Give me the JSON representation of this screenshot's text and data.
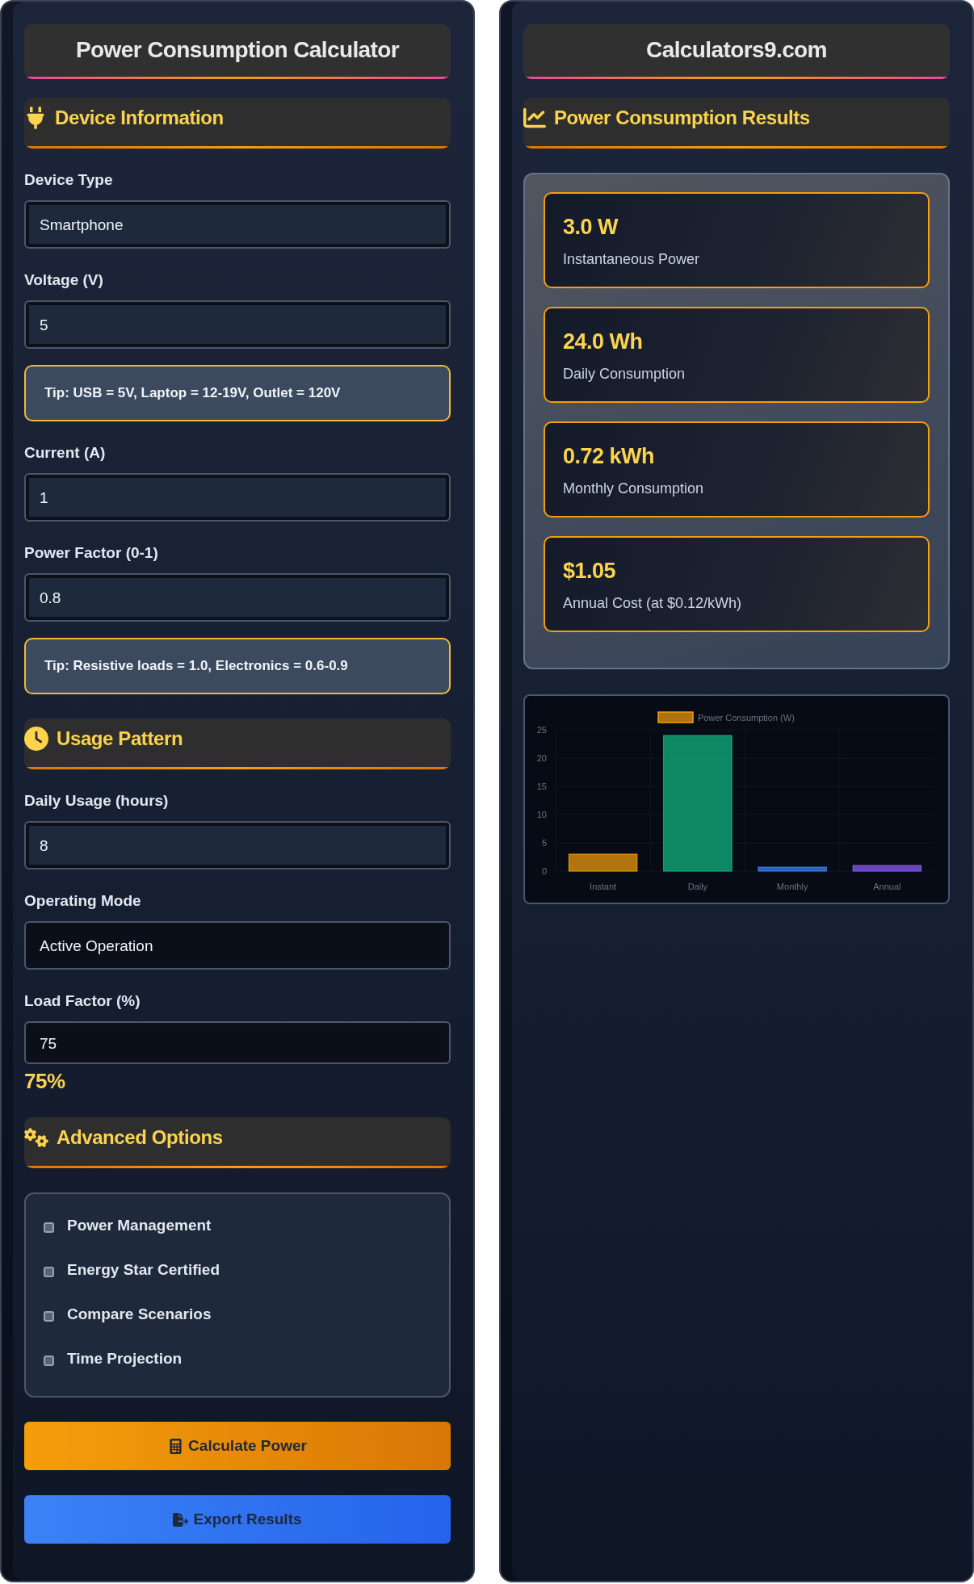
{
  "calculator": {
    "title": "Power Consumption Calculator",
    "sections": [
      {
        "heading": "Device Information",
        "items": [
          {
            "kind": "input",
            "label": "Device Type",
            "value": "Smartphone"
          },
          {
            "kind": "input",
            "label": "Voltage (V)",
            "value": "5"
          },
          {
            "kind": "tip",
            "text": "**Tip:** USB = 5V, Laptop = 12-19V, Outlet = 120V"
          },
          {
            "kind": "input",
            "label": "Current (A)",
            "value": "1"
          },
          {
            "kind": "input",
            "label": "Power Factor (0-1)",
            "value": "0.8"
          },
          {
            "kind": "tip",
            "text": "**Tip:** Resistive loads = 1.0, Electronics = 0.6-0.9"
          }
        ]
      },
      {
        "heading": "Usage Pattern",
        "items": [
          {
            "kind": "input",
            "label": "Daily Usage (hours)",
            "value": "8"
          },
          {
            "kind": "select",
            "label": "Operating Mode",
            "value": "Active Operation"
          },
          {
            "kind": "range",
            "label": "Load Factor (%)",
            "value": "75",
            "reading": "75%"
          }
        ]
      },
      {
        "heading": "Advanced Options",
        "items": [
          {
            "kind": "checks",
            "options": [
              {
                "label": "Power Management",
                "checked": false
              },
              {
                "label": "Energy Star Certified",
                "checked": false
              },
              {
                "label": "Compare Scenarios",
                "checked": false
              },
              {
                "label": "Time Projection",
                "checked": false
              }
            ]
          }
        ]
      }
    ],
    "buttons": [
      {
        "kind": "calculate",
        "label": "Calculate Power"
      },
      {
        "kind": "export",
        "label": "Export Results"
      }
    ]
  },
  "results": {
    "brand": "Calculators9.com",
    "heading": "Power Consumption Results",
    "cards": [
      {
        "value": "3.0 W",
        "label": "Instantaneous Power"
      },
      {
        "value": "24.0 Wh",
        "label": "Daily Consumption"
      },
      {
        "value": "0.72 kWh",
        "label": "Monthly Consumption"
      },
      {
        "value": "$1.05",
        "label": "Annual Cost (at $0.12/kWh)"
      }
    ],
    "chart_data": {
      "type": "bar",
      "categories": [
        "Instant",
        "Daily",
        "Monthly",
        "Annual"
      ],
      "series": [
        {
          "name": "Power Consumption (W)",
          "color": "#f59e0b",
          "colors": [
            "#f59e0b",
            "#10b981",
            "#3b82f6",
            "#8b5cf6"
          ],
          "values": [
            3,
            24,
            0.7,
            1
          ]
        }
      ],
      "ylim": [
        0,
        25
      ],
      "yticks": [
        0,
        5,
        10,
        15,
        20,
        25
      ]
    }
  }
}
